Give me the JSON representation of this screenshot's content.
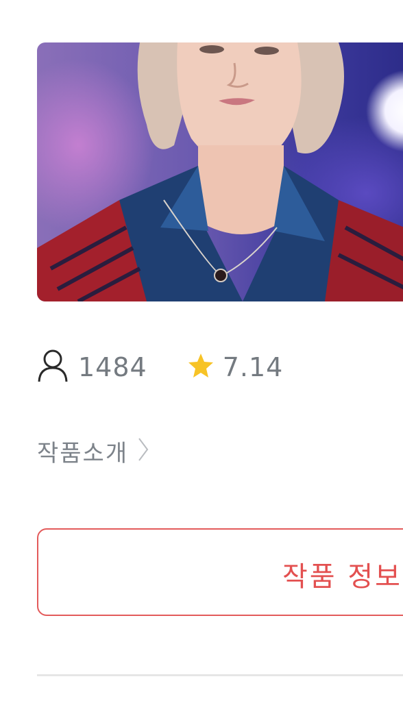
{
  "cover": {
    "icon": "cover-photo"
  },
  "stats": {
    "views_icon": "person-icon",
    "views": "1484",
    "rating_icon": "star-icon",
    "rating": "7.14",
    "star_color": "#f7c326"
  },
  "intro": {
    "label": "작품소개",
    "icon": "chevron-right-icon"
  },
  "info_button": {
    "label": "작품 정보",
    "color": "#e35a5a"
  }
}
